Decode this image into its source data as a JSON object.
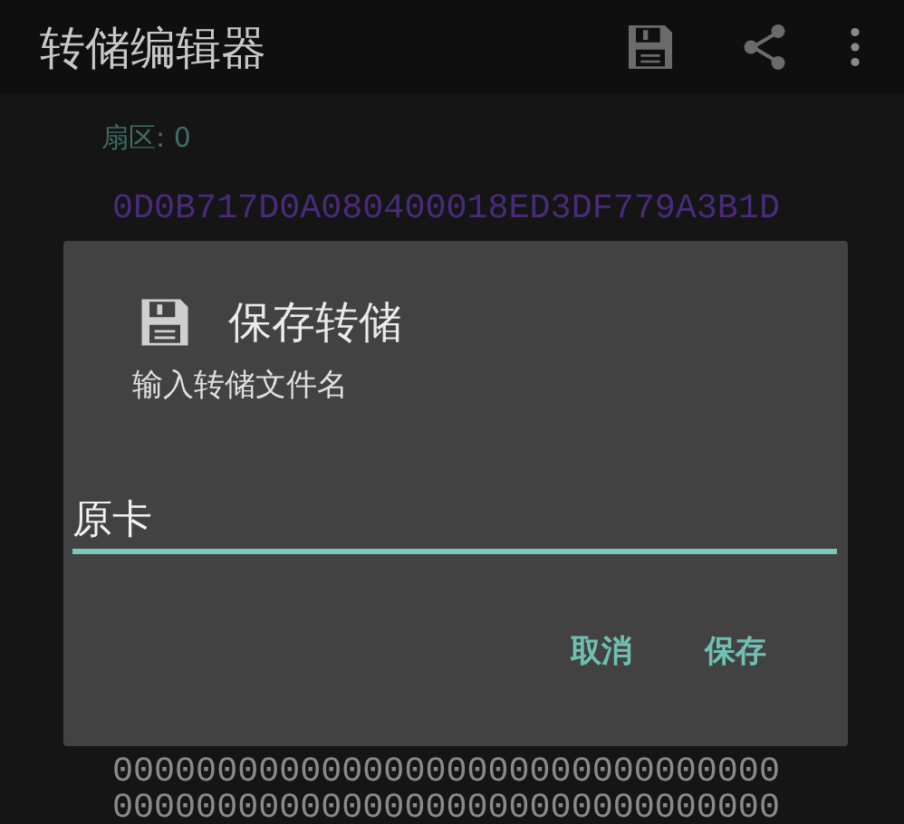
{
  "app_bar": {
    "title": "转储编辑器"
  },
  "sector": {
    "label": "扇区: 0"
  },
  "rows_above": [
    {
      "text": "0D0B717D0A080400018ED3DF779A3B1D",
      "kind": "uid"
    }
  ],
  "rows_below": [
    {
      "text": "00000000000000000000000000000000",
      "kind": "data"
    },
    {
      "text": "00000000000000000000000000000000",
      "kind": "data"
    }
  ],
  "dialog": {
    "title": "保存转储",
    "message": "输入转储文件名",
    "input": {
      "value": "原卡"
    },
    "buttons": [
      "取消",
      "保存"
    ]
  }
}
